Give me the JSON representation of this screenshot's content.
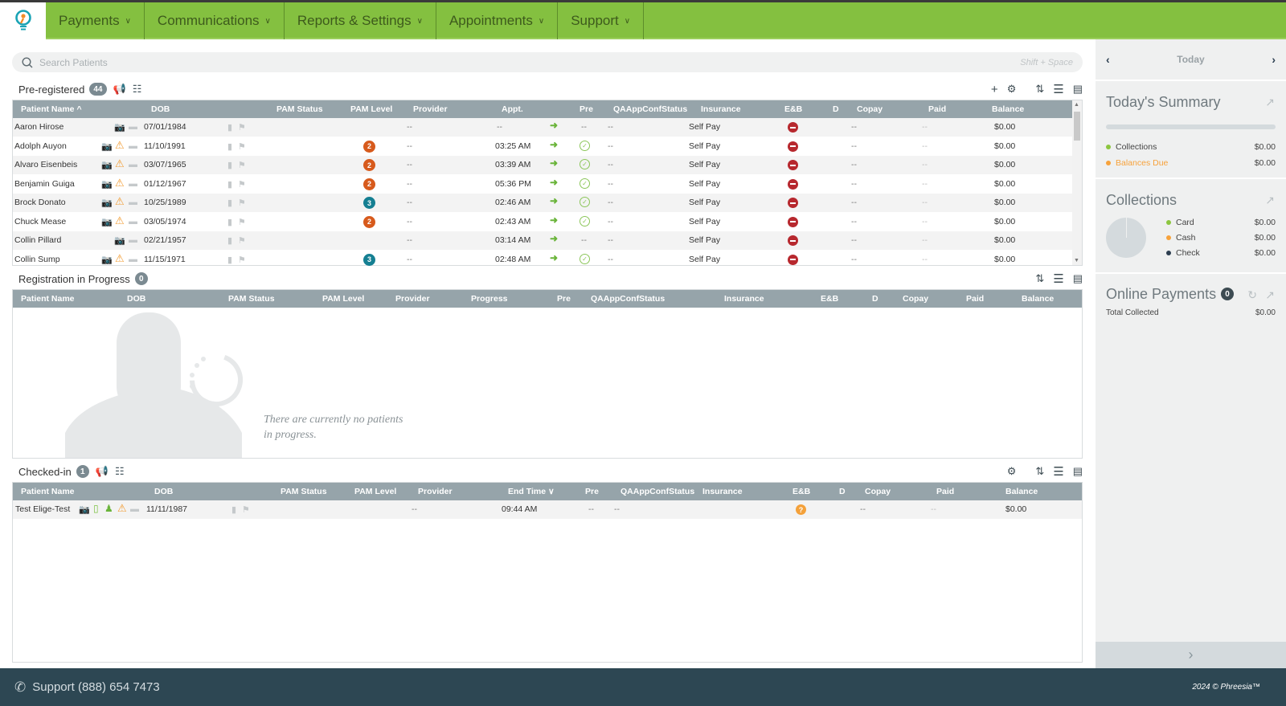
{
  "nav": {
    "items": [
      {
        "label": "Payments"
      },
      {
        "label": "Communications"
      },
      {
        "label": "Reports & Settings"
      },
      {
        "label": "Appointments"
      },
      {
        "label": "Support"
      }
    ]
  },
  "search": {
    "placeholder": "Search Patients",
    "shortcut": "Shift + Space"
  },
  "preregistered": {
    "title": "Pre-registered",
    "count": "44",
    "columns": [
      "Patient Name ^",
      "DOB",
      "PAM Status",
      "PAM Level",
      "Provider",
      "Appt.",
      "Pre",
      "QAAppConfStatus",
      "Insurance",
      "E&B",
      "D",
      "Copay",
      "Paid",
      "Balance"
    ],
    "rows": [
      {
        "name": "Aaron Hirose",
        "warn": false,
        "dob": "07/01/1984",
        "pam_level": "",
        "pam_color": "",
        "provider": "--",
        "appt": "--",
        "pre": "--",
        "qa": "--",
        "insurance": "Self Pay",
        "copay": "--",
        "paid": "--",
        "balance": "$0.00"
      },
      {
        "name": "Adolph Auyon",
        "warn": true,
        "dob": "11/10/1991",
        "pam_level": "2",
        "pam_color": "o",
        "provider": "--",
        "appt": "03:25 AM",
        "pre": "check",
        "qa": "--",
        "insurance": "Self Pay",
        "copay": "--",
        "paid": "--",
        "balance": "$0.00"
      },
      {
        "name": "Alvaro Eisenbeis",
        "warn": true,
        "dob": "03/07/1965",
        "pam_level": "2",
        "pam_color": "o",
        "provider": "--",
        "appt": "03:39 AM",
        "pre": "check",
        "qa": "--",
        "insurance": "Self Pay",
        "copay": "--",
        "paid": "--",
        "balance": "$0.00"
      },
      {
        "name": "Benjamin Guiga",
        "warn": true,
        "dob": "01/12/1967",
        "pam_level": "2",
        "pam_color": "o",
        "provider": "--",
        "appt": "05:36 PM",
        "pre": "check",
        "qa": "--",
        "insurance": "Self Pay",
        "copay": "--",
        "paid": "--",
        "balance": "$0.00"
      },
      {
        "name": "Brock Donato",
        "warn": true,
        "dob": "10/25/1989",
        "pam_level": "3",
        "pam_color": "t",
        "provider": "--",
        "appt": "02:46 AM",
        "pre": "check",
        "qa": "--",
        "insurance": "Self Pay",
        "copay": "--",
        "paid": "--",
        "balance": "$0.00"
      },
      {
        "name": "Chuck Mease",
        "warn": true,
        "dob": "03/05/1974",
        "pam_level": "2",
        "pam_color": "o",
        "provider": "--",
        "appt": "02:43 AM",
        "pre": "check",
        "qa": "--",
        "insurance": "Self Pay",
        "copay": "--",
        "paid": "--",
        "balance": "$0.00"
      },
      {
        "name": "Collin Pillard",
        "warn": false,
        "dob": "02/21/1957",
        "pam_level": "",
        "pam_color": "",
        "provider": "--",
        "appt": "03:14 AM",
        "pre": "--",
        "qa": "--",
        "insurance": "Self Pay",
        "copay": "--",
        "paid": "--",
        "balance": "$0.00"
      },
      {
        "name": "Collin Sump",
        "warn": true,
        "dob": "11/15/1971",
        "pam_level": "3",
        "pam_color": "t",
        "provider": "--",
        "appt": "02:48 AM",
        "pre": "check",
        "qa": "--",
        "insurance": "Self Pay",
        "copay": "--",
        "paid": "--",
        "balance": "$0.00"
      }
    ]
  },
  "in_progress": {
    "title": "Registration in Progress",
    "count": "0",
    "columns": [
      "Patient Name",
      "DOB",
      "PAM Status",
      "PAM Level",
      "Provider",
      "Progress",
      "Pre",
      "QAAppConfStatus",
      "Insurance",
      "E&B",
      "D",
      "Copay",
      "Paid",
      "Balance"
    ],
    "empty_line1": "There are currently no patients",
    "empty_line2": "in progress."
  },
  "checked_in": {
    "title": "Checked-in",
    "count": "1",
    "columns": [
      "Patient Name",
      "DOB",
      "PAM Status",
      "PAM Level",
      "Provider",
      "End Time ∨",
      "Pre",
      "QAAppConfStatus",
      "Insurance",
      "E&B",
      "D",
      "Copay",
      "Paid",
      "Balance"
    ],
    "rows": [
      {
        "name": "Test Elige-Test",
        "dob": "11/11/1987",
        "provider": "--",
        "end_time": "09:44 AM",
        "pre": "--",
        "qa": "--",
        "copay": "--",
        "paid": "--",
        "balance": "$0.00"
      }
    ]
  },
  "sidebar": {
    "date_label": "Today",
    "summary": {
      "title": "Today's Summary",
      "items": [
        {
          "label": "Collections",
          "value": "$0.00",
          "color": "#8cc63f"
        },
        {
          "label": "Balances Due",
          "value": "$0.00",
          "color": "#f7a23b"
        }
      ]
    },
    "collections": {
      "title": "Collections",
      "items": [
        {
          "label": "Card",
          "value": "$0.00",
          "color": "#8cc63f"
        },
        {
          "label": "Cash",
          "value": "$0.00",
          "color": "#f7a23b"
        },
        {
          "label": "Check",
          "value": "$0.00",
          "color": "#2c3e50"
        }
      ]
    },
    "online": {
      "title": "Online Payments",
      "count": "0",
      "total_label": "Total Collected",
      "total_value": "$0.00"
    }
  },
  "footer": {
    "support": "Support (888) 654 7473",
    "copyright": "2024 © Phreesia™"
  },
  "colors": {
    "brand_green": "#84c040",
    "footer": "#2d4753",
    "header_grid": "#96a4aa"
  }
}
